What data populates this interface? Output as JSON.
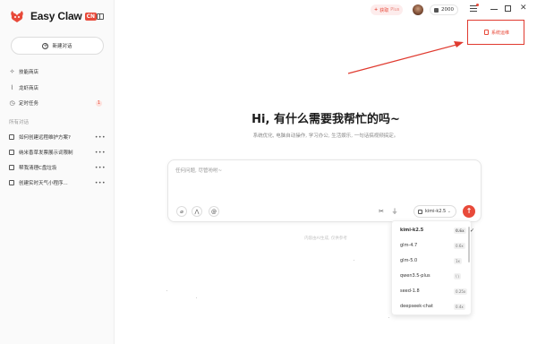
{
  "app": {
    "name": "Easy Claw",
    "badge": "CN"
  },
  "sidebar": {
    "new_chat_label": "新建对话",
    "nav": [
      {
        "label": "技能商店",
        "icon": "sparkle-icon"
      },
      {
        "label": "龙虾商店",
        "icon": "lobster-icon"
      },
      {
        "label": "定时任务",
        "icon": "clock-icon",
        "badge": "1"
      }
    ],
    "section_title": "所有对话",
    "conversations": [
      {
        "label": "如何创建远程维护方案?"
      },
      {
        "label": "纳米香草发票展示词限制"
      },
      {
        "label": "帮我清理C盘垃圾"
      },
      {
        "label": "创建实时天气小程序..."
      }
    ]
  },
  "topbar": {
    "pro_prefix": "+",
    "pro_label": "获取",
    "pro_suffix": "Plus",
    "credits": "2000",
    "system_status": "系统运维"
  },
  "main": {
    "headline": "Hi, 有什么需要我帮忙的吗~",
    "subline": "系统优化, 电脑自动操作, 学习办公, 生活娱乐, 一句话搞视频搞定。",
    "input_placeholder": "任何问题, 尽管吩咐~",
    "disclaimer": "内容由AI生成, 仅供参考",
    "selected_model": "kimi-k2.5"
  },
  "model_dropdown": [
    {
      "name": "kimi-k2.5",
      "tag": "0.6x",
      "selected": true
    },
    {
      "name": "glm-4.7",
      "tag": "0.6x",
      "selected": false
    },
    {
      "name": "glm-5.0",
      "tag": "1x",
      "selected": false
    },
    {
      "name": "qwen3.5-plus",
      "tag": "\\ \\",
      "selected": false
    },
    {
      "name": "seed-1.8",
      "tag": "0.25x",
      "selected": false
    },
    {
      "name": "deepseek-chat",
      "tag": "0.4x",
      "selected": false
    }
  ],
  "colors": {
    "accent": "#e84a3a",
    "annotation": "#e03a2f"
  }
}
